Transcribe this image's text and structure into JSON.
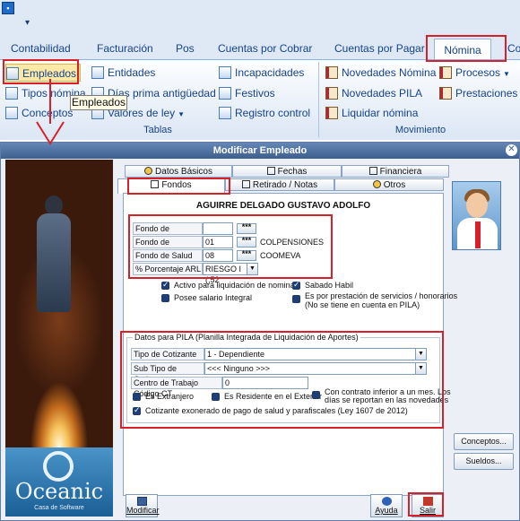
{
  "ribbon": {
    "tabs": [
      "Contabilidad",
      "Facturación",
      "Pos",
      "Cuentas por Cobrar",
      "Cuentas por Pagar",
      "Nómina",
      "Co"
    ],
    "active_tab": "Nómina",
    "tablas": {
      "items": [
        "Empleados",
        "Entidades",
        "Incapacidades",
        "Tipos nómina",
        "Días prima antigüedad",
        "Festivos",
        "Conceptos",
        "Valores de ley",
        "Registro control"
      ],
      "label": "Tablas"
    },
    "movimiento": {
      "items": [
        "Novedades Nómina",
        "Procesos",
        "Novedades PILA",
        "Prestaciones",
        "Liquidar nómina"
      ],
      "label": "Movimiento"
    },
    "tooltip": "Empleados"
  },
  "dialog": {
    "title": "Modificar Empleado",
    "tabs": [
      "Datos Básicos",
      "Fechas",
      "Financiera",
      "Fondos",
      "Retirado / Notas",
      "Otros"
    ],
    "employee_name": "AGUIRRE DELGADO GUSTAVO ADOLFO",
    "fondos": [
      {
        "label": "Fondo de Cesantias",
        "value": "",
        "entity": ""
      },
      {
        "label": "Fondo de Pensiones",
        "value": "01",
        "entity": "COLPENSIONES"
      },
      {
        "label": "Fondo de Salud EPS",
        "value": "08",
        "entity": "COOMEVA"
      }
    ],
    "arl_label": "% Porcentaje ARL",
    "arl_value": "RIESGO I (,52",
    "dots": "***",
    "checks": [
      {
        "label": "Activo para liquidación de nomina",
        "checked": true
      },
      {
        "label": "Sabado Habil",
        "checked": true
      },
      {
        "label": "Posee salario Integral",
        "checked": false
      },
      {
        "label": "Es por prestación de servicios / honorarios",
        "label2": "(No se tiene en cuenta en PILA)",
        "checked": false
      }
    ],
    "pila": {
      "title": "Datos para PILA (Planilla Integrada de Liquidación de Aportes)",
      "tipo_cotizante_label": "Tipo de Cotizante",
      "tipo_cotizante_value": "1 - Dependiente",
      "subtipo_label": "Sub Tipo de Cotizante",
      "subtipo_value": "<<< Ninguno >>>",
      "centro_label": "Centro de Trabajo Código CT",
      "centro_value": "0",
      "extranjero": "Es Extranjero",
      "residente": "Es Residente en el Exterior",
      "contrato_1": "Con contrato inferior a un mes. Los",
      "contrato_2": "días se reportan en las novedades",
      "exonerado": "Cotizante exonerado de pago de salud y parafiscales (Ley 1607 de 2012)"
    },
    "buttons": {
      "conceptos": "Conceptos...",
      "sueldos": "Sueldos...",
      "modificar": "Modificar",
      "ayuda": "Ayuda",
      "salir": "Salir"
    },
    "brand": {
      "name": "Oceanic",
      "sub": "Casa de Software"
    }
  }
}
